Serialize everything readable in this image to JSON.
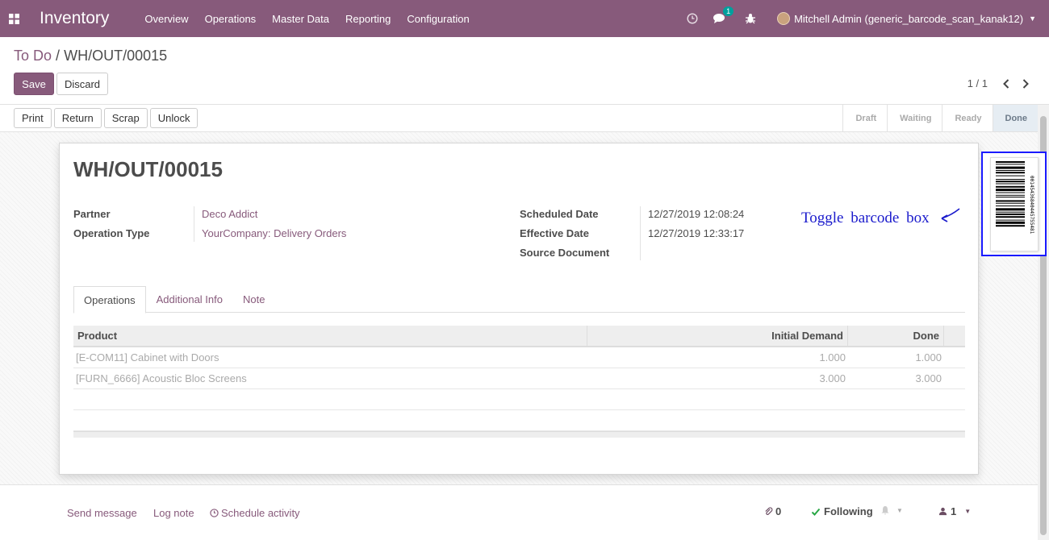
{
  "navbar": {
    "app_title": "Inventory",
    "menu": [
      "Overview",
      "Operations",
      "Master Data",
      "Reporting",
      "Configuration"
    ],
    "messages_badge": "1",
    "user_name": "Mitchell Admin (generic_barcode_scan_kanak12)",
    "brand_color": "#875a7b"
  },
  "control": {
    "breadcrumb_parent": "To Do",
    "breadcrumb_sep": "/",
    "breadcrumb_current": "WH/OUT/00015",
    "save_label": "Save",
    "discard_label": "Discard",
    "pager": "1 / 1"
  },
  "statusbar": {
    "buttons": [
      "Print",
      "Return",
      "Scrap",
      "Unlock"
    ],
    "stages": [
      "Draft",
      "Waiting",
      "Ready",
      "Done"
    ],
    "active_stage": "Done"
  },
  "record": {
    "title": "WH/OUT/00015",
    "fields_left": [
      {
        "label": "Partner",
        "value": "Deco Addict"
      },
      {
        "label": "Operation Type",
        "value": "YourCompany: Delivery Orders"
      }
    ],
    "fields_right": [
      {
        "label": "Scheduled Date",
        "value": "12/27/2019 12:08:24"
      },
      {
        "label": "Effective Date",
        "value": "12/27/2019 12:33:17"
      },
      {
        "label": "Source Document",
        "value": ""
      }
    ]
  },
  "tabs": [
    "Operations",
    "Additional Info",
    "Note"
  ],
  "table": {
    "columns": [
      "Product",
      "Initial Demand",
      "Done"
    ],
    "rows": [
      {
        "product": "[E-COM11] Cabinet with Doors",
        "demand": "1.000",
        "done": "1.000"
      },
      {
        "product": "[FURN_6666] Acoustic Bloc Screens",
        "demand": "3.000",
        "done": "3.000"
      }
    ]
  },
  "barcode": {
    "digits": "00145436840445755481",
    "annotation": "Toggle barcode box",
    "annotation_color": "#1a1acc"
  },
  "chatter": {
    "send_message": "Send message",
    "log_note": "Log note",
    "schedule_activity": "Schedule activity",
    "attachments_count": "0",
    "following": "Following",
    "followers_count": "1"
  }
}
